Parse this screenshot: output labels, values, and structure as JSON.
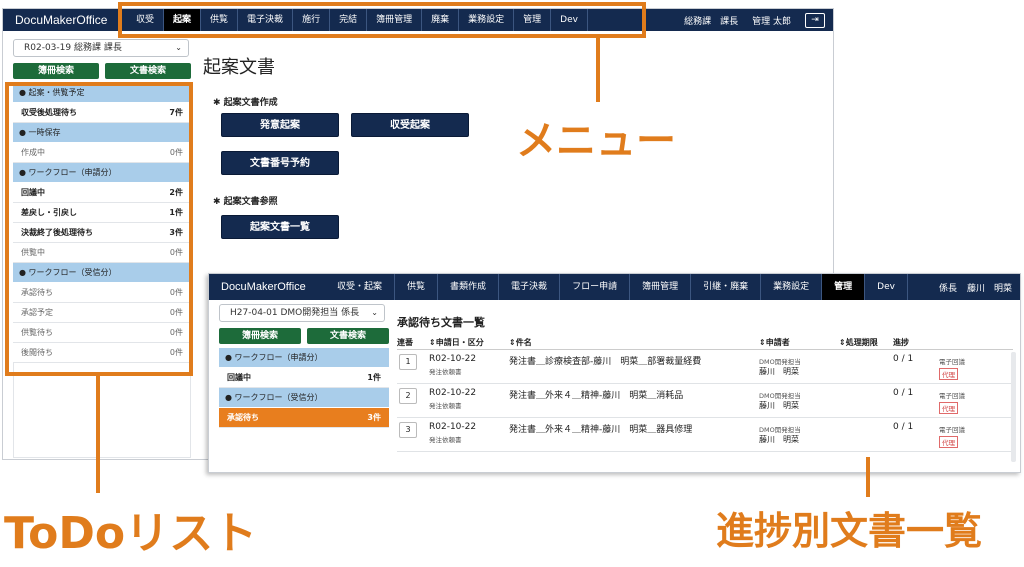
{
  "back_window": {
    "brand": "DocuMakerOffice",
    "menu": [
      "収受",
      "起案",
      "供覧",
      "電子決裁",
      "施行",
      "完結",
      "簿冊管理",
      "廃棄",
      "業務設定",
      "管理",
      "Dev"
    ],
    "active_menu_index": 1,
    "user_dept": "総務課　課長",
    "user_name": "管理 太郎",
    "logout_icon": "logout-icon",
    "sidebar": {
      "select_value": "R02-03-19 総務課 課長",
      "btn_ledger_search": "簿冊検索",
      "btn_doc_search": "文書検索",
      "todo": [
        {
          "type": "header",
          "label": "● 起案・供覧予定"
        },
        {
          "type": "row",
          "label": "収受後処理待ち",
          "count": "7件",
          "style": "bold"
        },
        {
          "type": "header",
          "label": "● 一時保存"
        },
        {
          "type": "row",
          "label": "作成中",
          "count": "0件",
          "style": "muted"
        },
        {
          "type": "header",
          "label": "● ワークフロー（申請分）"
        },
        {
          "type": "row",
          "label": "回議中",
          "count": "2件",
          "style": "bold"
        },
        {
          "type": "row",
          "label": "差戻し・引戻し",
          "count": "1件",
          "style": "bold"
        },
        {
          "type": "row",
          "label": "決裁終了後処理待ち",
          "count": "3件",
          "style": "bold"
        },
        {
          "type": "row",
          "label": "供覧中",
          "count": "0件",
          "style": "muted"
        },
        {
          "type": "header",
          "label": "● ワークフロー（受信分）"
        },
        {
          "type": "row",
          "label": "承認待ち",
          "count": "0件",
          "style": "muted"
        },
        {
          "type": "row",
          "label": "承認予定",
          "count": "0件",
          "style": "muted"
        },
        {
          "type": "row",
          "label": "供覧待ち",
          "count": "0件",
          "style": "muted"
        },
        {
          "type": "row",
          "label": "後閲待ち",
          "count": "0件",
          "style": "muted"
        }
      ]
    },
    "main": {
      "title": "起案文書",
      "section_create": "✱ 起案文書作成",
      "btn_hatsui": "発意起案",
      "btn_shuju": "収受起案",
      "btn_number": "文書番号予約",
      "section_ref": "✱ 起案文書参照",
      "btn_list": "起案文書一覧"
    }
  },
  "front_window": {
    "brand": "DocuMakerOffice",
    "menu": [
      "収受・起案",
      "供覧",
      "書類作成",
      "電子決裁",
      "フロー申請",
      "簿冊管理",
      "引継・廃棄",
      "業務設定",
      "管理",
      "Dev"
    ],
    "active_menu_index": 8,
    "user_role": "係長",
    "user_name": "藤川　明菜",
    "sidebar": {
      "select_value": "H27-04-01 DMO開発担当 係長",
      "btn_ledger_search": "簿冊検索",
      "btn_doc_search": "文書検索",
      "todo": [
        {
          "type": "header",
          "label": "● ワークフロー（申請分）"
        },
        {
          "type": "row",
          "label": "回議中",
          "count": "1件",
          "style": "bold"
        },
        {
          "type": "header",
          "label": "● ワークフロー（受信分）"
        },
        {
          "type": "row",
          "label": "承認待ち",
          "count": "3件",
          "style": "active"
        }
      ]
    },
    "list": {
      "title": "承認待ち文書一覧",
      "headers": {
        "no": "連番",
        "date": "⇕申請日・区分",
        "name": "⇕件名",
        "applicant": "⇕申請者",
        "limit": "⇕処理期限",
        "progress": "進捗"
      },
      "rows": [
        {
          "no": "1",
          "date": "R02-10-22",
          "kind": "発注依頼書",
          "name": "発注書＿診療検査部-藤川　明菜＿部署裁量経費",
          "dept": "DMO開発担当",
          "applicant": "藤川　明菜",
          "progress": "0 / 1",
          "route": "電子回議",
          "tag": "代理"
        },
        {
          "no": "2",
          "date": "R02-10-22",
          "kind": "発注依頼書",
          "name": "発注書＿外来４＿精神-藤川　明菜＿消耗品",
          "dept": "DMO開発担当",
          "applicant": "藤川　明菜",
          "progress": "0 / 1",
          "route": "電子回議",
          "tag": "代理"
        },
        {
          "no": "3",
          "date": "R02-10-22",
          "kind": "発注依頼書",
          "name": "発注書＿外来４＿精神-藤川　明菜＿器具修理",
          "dept": "DMO開発担当",
          "applicant": "藤川　明菜",
          "progress": "0 / 1",
          "route": "電子回議",
          "tag": "代理"
        }
      ]
    }
  },
  "annotations": {
    "menu_label": "メニュー",
    "todo_label": "ToDoリスト",
    "progress_label": "進捗別文書一覧",
    "color": "#e07c1c"
  }
}
